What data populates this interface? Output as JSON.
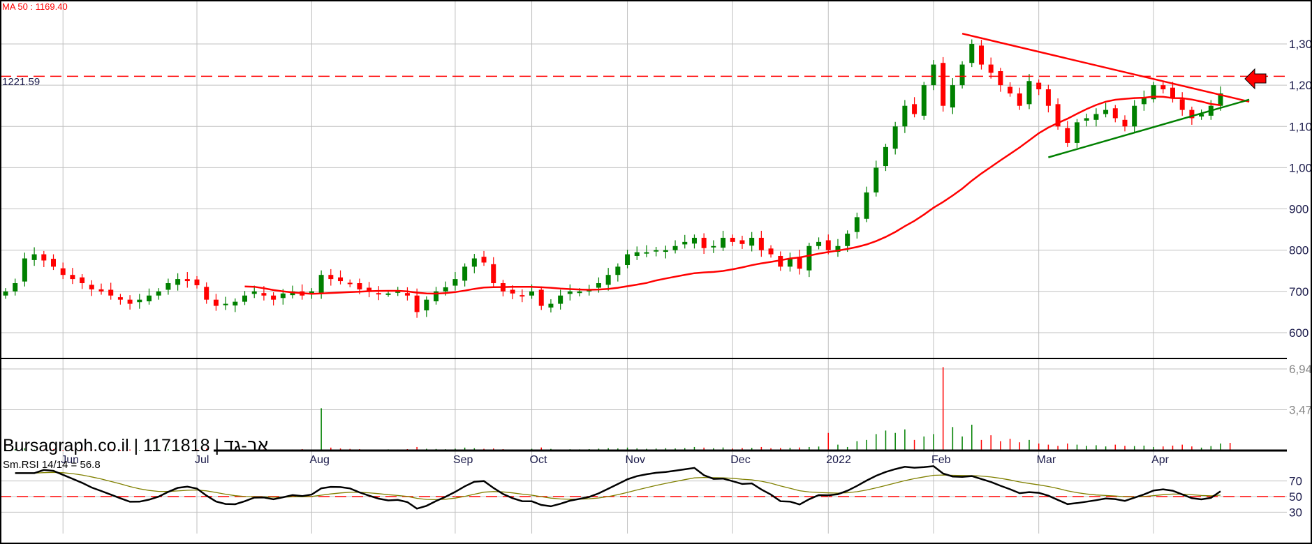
{
  "header": {
    "ma_label": "MA 50 : 1169.40",
    "level_label": "1221.59"
  },
  "footer": {
    "brand": "Bursagraph.co.il | 1171818 | אב-גד",
    "rsi_label": "Sm.RSI 14/14 = 56.8"
  },
  "colors": {
    "up": "#008000",
    "down": "#ff0000",
    "ma": "#ff0000",
    "rsi": "#000000",
    "rsi_signal": "#808000",
    "grid": "#c0c0c0"
  },
  "chart_data": [
    {
      "type": "candlestick",
      "title": "Price",
      "yticks": [
        "600",
        "700",
        "800",
        "900",
        "1,000",
        "1,100",
        "1,200",
        "1,300"
      ],
      "ytick_values": [
        600,
        700,
        800,
        900,
        1000,
        1100,
        1200,
        1300
      ],
      "ylim": [
        540,
        1370
      ],
      "months": [
        "Jun",
        "Jul",
        "Aug",
        "Sep",
        "Oct",
        "Nov",
        "Dec",
        "2022",
        "Feb",
        "Mar",
        "Apr"
      ],
      "month_index": [
        6,
        20,
        32,
        47,
        55,
        65,
        76,
        86,
        97,
        108,
        120
      ],
      "closes": [
        700,
        720,
        780,
        790,
        775,
        760,
        740,
        730,
        720,
        705,
        700,
        690,
        680,
        670,
        680,
        690,
        700,
        720,
        730,
        725,
        715,
        680,
        665,
        670,
        675,
        690,
        700,
        690,
        680,
        695,
        700,
        690,
        700,
        740,
        730,
        725,
        720,
        705,
        700,
        695,
        695,
        700,
        690,
        650,
        680,
        700,
        710,
        730,
        760,
        780,
        770,
        720,
        700,
        695,
        690,
        700,
        665,
        670,
        690,
        700,
        700,
        705,
        720,
        740,
        760,
        790,
        795,
        795,
        800,
        800,
        810,
        820,
        830,
        805,
        810,
        830,
        820,
        815,
        830,
        800,
        790,
        760,
        780,
        755,
        810,
        820,
        800,
        810,
        840,
        880,
        940,
        1000,
        1050,
        1100,
        1150,
        1130,
        1200,
        1250,
        1150,
        1200,
        1250,
        1300,
        1250,
        1230,
        1200,
        1180,
        1150,
        1210,
        1190,
        1150,
        1100,
        1060,
        1110,
        1120,
        1130,
        1140,
        1120,
        1100,
        1150,
        1170,
        1200,
        1190,
        1170,
        1140,
        1120,
        1130,
        1150,
        1180
      ],
      "ma_period": 25,
      "ma_label": "MA 50",
      "ma_last": 1169.4,
      "resistance_level": 1221.59,
      "trendlines": [
        {
          "color": "red",
          "from_index": 100,
          "from_value": 1325,
          "to_index": 130,
          "to_value": 1160
        },
        {
          "color": "green",
          "from_index": 109,
          "from_value": 1025,
          "to_index": 130,
          "to_value": 1165
        }
      ]
    },
    {
      "type": "bar",
      "title": "Volume",
      "yticks": [
        "3,472",
        "6,944"
      ],
      "ytick_values": [
        3472,
        6944
      ],
      "values": [
        150,
        120,
        200,
        90,
        80,
        110,
        60,
        70,
        90,
        120,
        80,
        100,
        60,
        90,
        50,
        70,
        100,
        110,
        90,
        60,
        80,
        150,
        60,
        80,
        70,
        90,
        60,
        100,
        80,
        70,
        90,
        120,
        60,
        3600,
        250,
        180,
        140,
        120,
        90,
        80,
        100,
        90,
        120,
        300,
        150,
        130,
        110,
        160,
        250,
        200,
        150,
        180,
        120,
        90,
        80,
        150,
        260,
        140,
        90,
        110,
        100,
        120,
        160,
        200,
        180,
        250,
        190,
        150,
        170,
        200,
        180,
        210,
        300,
        250,
        200,
        260,
        180,
        220,
        230,
        300,
        200,
        220,
        240,
        260,
        300,
        340,
        1500,
        500,
        300,
        800,
        900,
        1400,
        1700,
        1500,
        1800,
        900,
        1200,
        1400,
        7100,
        2000,
        1200,
        2200,
        900,
        1300,
        800,
        1000,
        700,
        900,
        600,
        500,
        400,
        600,
        500,
        400,
        450,
        350,
        500,
        400,
        380,
        420,
        300,
        350,
        420,
        500,
        350,
        250,
        380,
        600,
        650
      ],
      "ylim": [
        0,
        7400
      ]
    },
    {
      "type": "line",
      "title": "Sm.RSI 14/14",
      "yticks": [
        "30",
        "50",
        "70"
      ],
      "ytick_values": [
        30,
        50,
        70
      ],
      "last_value": 56.8,
      "ylim": [
        15,
        100
      ]
    }
  ]
}
